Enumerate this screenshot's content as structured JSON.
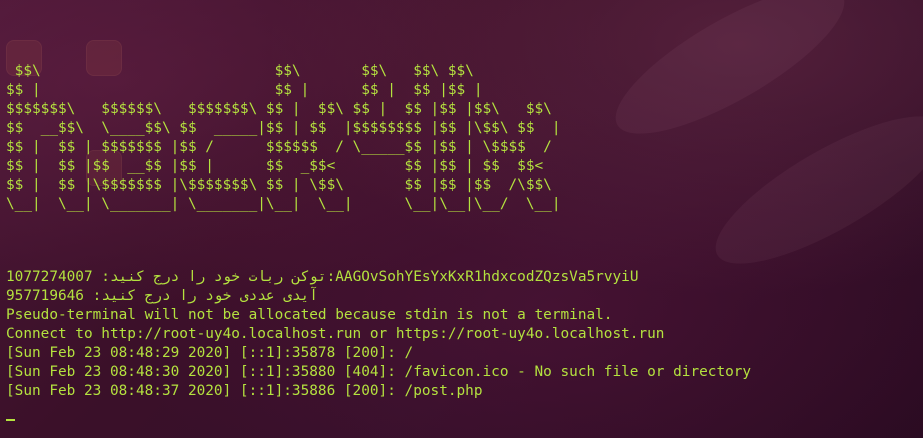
{
  "banner": [
    " $$\\                           $$\\       $$\\   $$\\ $$\\",
    "$$ |                           $$ |      $$ |  $$ |$$ |",
    "$$$$$$$\\   $$$$$$\\   $$$$$$$\\ $$ |  $$\\ $$ |  $$ |$$ |$$\\   $$\\",
    "$$  __$$\\  \\____$$\\ $$  _____|$$ | $$  |$$$$$$$$ |$$ |\\$$\\ $$  |",
    "$$ |  $$ | $$$$$$$ |$$ /      $$$$$$  / \\_____$$ |$$ | \\$$$$  /",
    "$$ |  $$ |$$  __$$ |$$ |      $$  _$$<        $$ |$$ | $$  $$<",
    "$$ |  $$ |\\$$$$$$$ |\\$$$$$$$\\ $$ | \\$$\\       $$ |$$ |$$  /\\$$\\",
    "\\__|  \\__| \\_______| \\_______|\\__|  \\__|      \\__|\\__|\\__/  \\__|"
  ],
  "output": [
    "1077274007 :توکن ربات خود را درج کنید:AAGOvSohYEsYxKxR1hdxcodZQzsVa5rvyiU",
    "957719646 :آیدی عددی خود را درج کنید",
    "Pseudo-terminal will not be allocated because stdin is not a terminal.",
    "Connect to http://root-uy4o.localhost.run or https://root-uy4o.localhost.run",
    "[Sun Feb 23 08:48:29 2020] [::1]:35878 [200]: /",
    "[Sun Feb 23 08:48:30 2020] [::1]:35880 [404]: /favicon.ico - No such file or directory",
    "[Sun Feb 23 08:48:37 2020] [::1]:35886 [200]: /post.php"
  ],
  "colors": {
    "text": "#b4e23f",
    "background": "#3a1029"
  }
}
